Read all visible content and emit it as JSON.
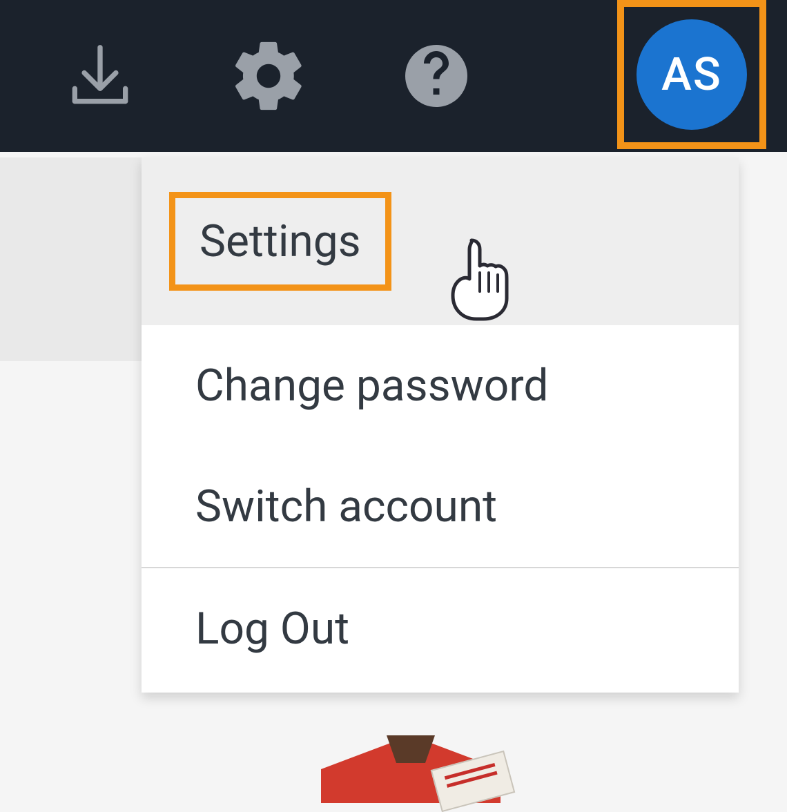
{
  "topbar": {
    "download_icon": "download-icon",
    "gear_icon": "gear-icon",
    "help_icon": "help-icon",
    "avatar_initials": "AS"
  },
  "menu": {
    "items": [
      {
        "label": "Settings"
      },
      {
        "label": "Change password"
      },
      {
        "label": "Switch account"
      },
      {
        "label": "Log Out"
      }
    ]
  },
  "colors": {
    "highlight": "#f39318",
    "avatar_bg": "#1b74d0",
    "topbar_bg": "#1b222c"
  }
}
